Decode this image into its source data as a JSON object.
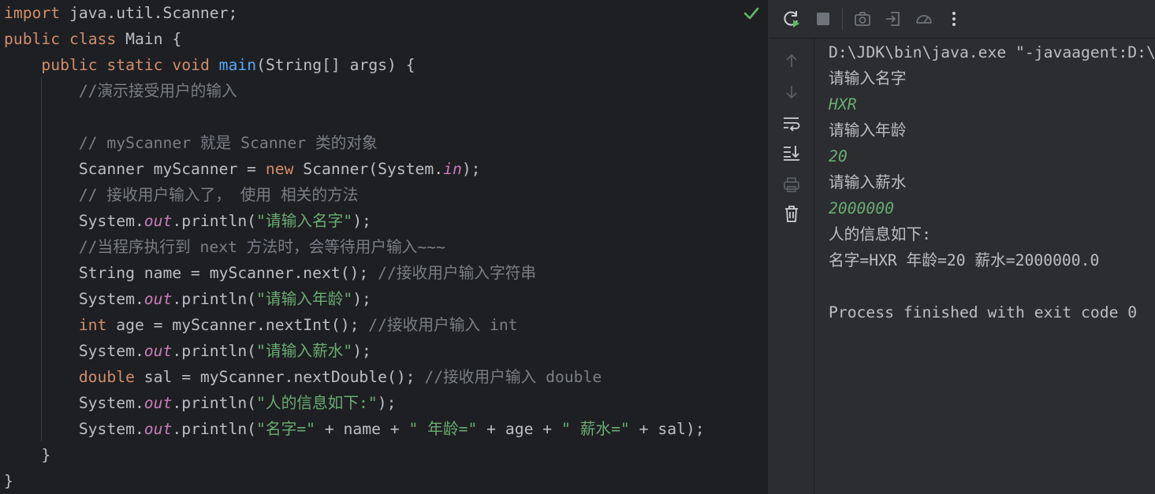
{
  "editor": {
    "lines": [
      [
        {
          "t": "import",
          "c": "kw"
        },
        {
          "t": " java.util.Scanner;",
          "c": ""
        }
      ],
      [
        {
          "t": "public",
          "c": "kw"
        },
        {
          "t": " ",
          "c": ""
        },
        {
          "t": "class",
          "c": "kw"
        },
        {
          "t": " Main {",
          "c": ""
        }
      ],
      [
        {
          "t": "    ",
          "c": ""
        },
        {
          "t": "public",
          "c": "kw"
        },
        {
          "t": " ",
          "c": ""
        },
        {
          "t": "static",
          "c": "kw"
        },
        {
          "t": " ",
          "c": ""
        },
        {
          "t": "void",
          "c": "kw"
        },
        {
          "t": " ",
          "c": ""
        },
        {
          "t": "main",
          "c": "fn"
        },
        {
          "t": "(String[] args) {",
          "c": ""
        }
      ],
      [
        {
          "t": "        //演示接受用户的输入",
          "c": "cm"
        }
      ],
      [],
      [
        {
          "t": "        // myScanner 就是 Scanner 类的对象",
          "c": "cm"
        }
      ],
      [
        {
          "t": "        Scanner myScanner = ",
          "c": ""
        },
        {
          "t": "new",
          "c": "kw"
        },
        {
          "t": " Scanner(System.",
          "c": ""
        },
        {
          "t": "in",
          "c": "fld"
        },
        {
          "t": ");",
          "c": ""
        }
      ],
      [
        {
          "t": "        // 接收用户输入了， 使用 相关的方法",
          "c": "cm"
        }
      ],
      [
        {
          "t": "        System.",
          "c": ""
        },
        {
          "t": "out",
          "c": "fld"
        },
        {
          "t": ".println(",
          "c": ""
        },
        {
          "t": "\"请输入名字\"",
          "c": "str"
        },
        {
          "t": ");",
          "c": ""
        }
      ],
      [
        {
          "t": "        //当程序执行到 next 方法时，会等待用户输入~~~",
          "c": "cm"
        }
      ],
      [
        {
          "t": "        String name = myScanner.next(); ",
          "c": ""
        },
        {
          "t": "//接收用户输入字符串",
          "c": "cm"
        }
      ],
      [
        {
          "t": "        System.",
          "c": ""
        },
        {
          "t": "out",
          "c": "fld"
        },
        {
          "t": ".println(",
          "c": ""
        },
        {
          "t": "\"请输入年龄\"",
          "c": "str"
        },
        {
          "t": ");",
          "c": ""
        }
      ],
      [
        {
          "t": "        ",
          "c": ""
        },
        {
          "t": "int",
          "c": "kw"
        },
        {
          "t": " age = myScanner.nextInt(); ",
          "c": ""
        },
        {
          "t": "//接收用户输入 int",
          "c": "cm"
        }
      ],
      [
        {
          "t": "        System.",
          "c": ""
        },
        {
          "t": "out",
          "c": "fld"
        },
        {
          "t": ".println(",
          "c": ""
        },
        {
          "t": "\"请输入薪水\"",
          "c": "str"
        },
        {
          "t": ");",
          "c": ""
        }
      ],
      [
        {
          "t": "        ",
          "c": ""
        },
        {
          "t": "double",
          "c": "kw"
        },
        {
          "t": " sal = myScanner.nextDouble(); ",
          "c": ""
        },
        {
          "t": "//接收用户输入 double",
          "c": "cm"
        }
      ],
      [
        {
          "t": "        System.",
          "c": ""
        },
        {
          "t": "out",
          "c": "fld"
        },
        {
          "t": ".println(",
          "c": ""
        },
        {
          "t": "\"人的信息如下:\"",
          "c": "str"
        },
        {
          "t": ");",
          "c": ""
        }
      ],
      [
        {
          "t": "        System.",
          "c": ""
        },
        {
          "t": "out",
          "c": "fld"
        },
        {
          "t": ".println(",
          "c": ""
        },
        {
          "t": "\"名字=\"",
          "c": "str"
        },
        {
          "t": " + name + ",
          "c": ""
        },
        {
          "t": "\" 年龄=\"",
          "c": "str"
        },
        {
          "t": " + age + ",
          "c": ""
        },
        {
          "t": "\" 薪水=\"",
          "c": "str"
        },
        {
          "t": " + sal);",
          "c": ""
        }
      ],
      [
        {
          "t": "    }",
          "c": ""
        }
      ],
      [
        {
          "t": "}",
          "c": ""
        }
      ]
    ],
    "status_icon": "checkmark-icon"
  },
  "run_toolbar": {
    "icons": [
      "rerun-icon",
      "stop-icon",
      "camera-icon",
      "attach-icon",
      "profiler-icon",
      "more-icon"
    ]
  },
  "side_toolbar": {
    "icons": [
      "arrow-up-icon",
      "arrow-down-icon",
      "soft-wrap-icon",
      "scroll-to-end-icon",
      "print-icon",
      "trash-icon"
    ]
  },
  "console": {
    "lines": [
      {
        "t": "D:\\JDK\\bin\\java.exe \"-javaagent:D:\\",
        "c": ""
      },
      {
        "t": "请输入名字",
        "c": ""
      },
      {
        "t": "HXR",
        "c": "cin"
      },
      {
        "t": "请输入年龄",
        "c": ""
      },
      {
        "t": "20",
        "c": "cin"
      },
      {
        "t": "请输入薪水",
        "c": ""
      },
      {
        "t": "2000000",
        "c": "cin"
      },
      {
        "t": "人的信息如下:",
        "c": ""
      },
      {
        "t": "名字=HXR 年龄=20 薪水=2000000.0",
        "c": ""
      },
      {
        "t": "",
        "c": ""
      },
      {
        "t": "Process finished with exit code 0",
        "c": ""
      }
    ]
  },
  "colors": {
    "keyword": "#cf8e6d",
    "function": "#56a8f5",
    "string": "#6aab73",
    "comment": "#7a7e85",
    "field": "#c77dbb",
    "text": "#bcbec4",
    "check": "#5fb865"
  }
}
